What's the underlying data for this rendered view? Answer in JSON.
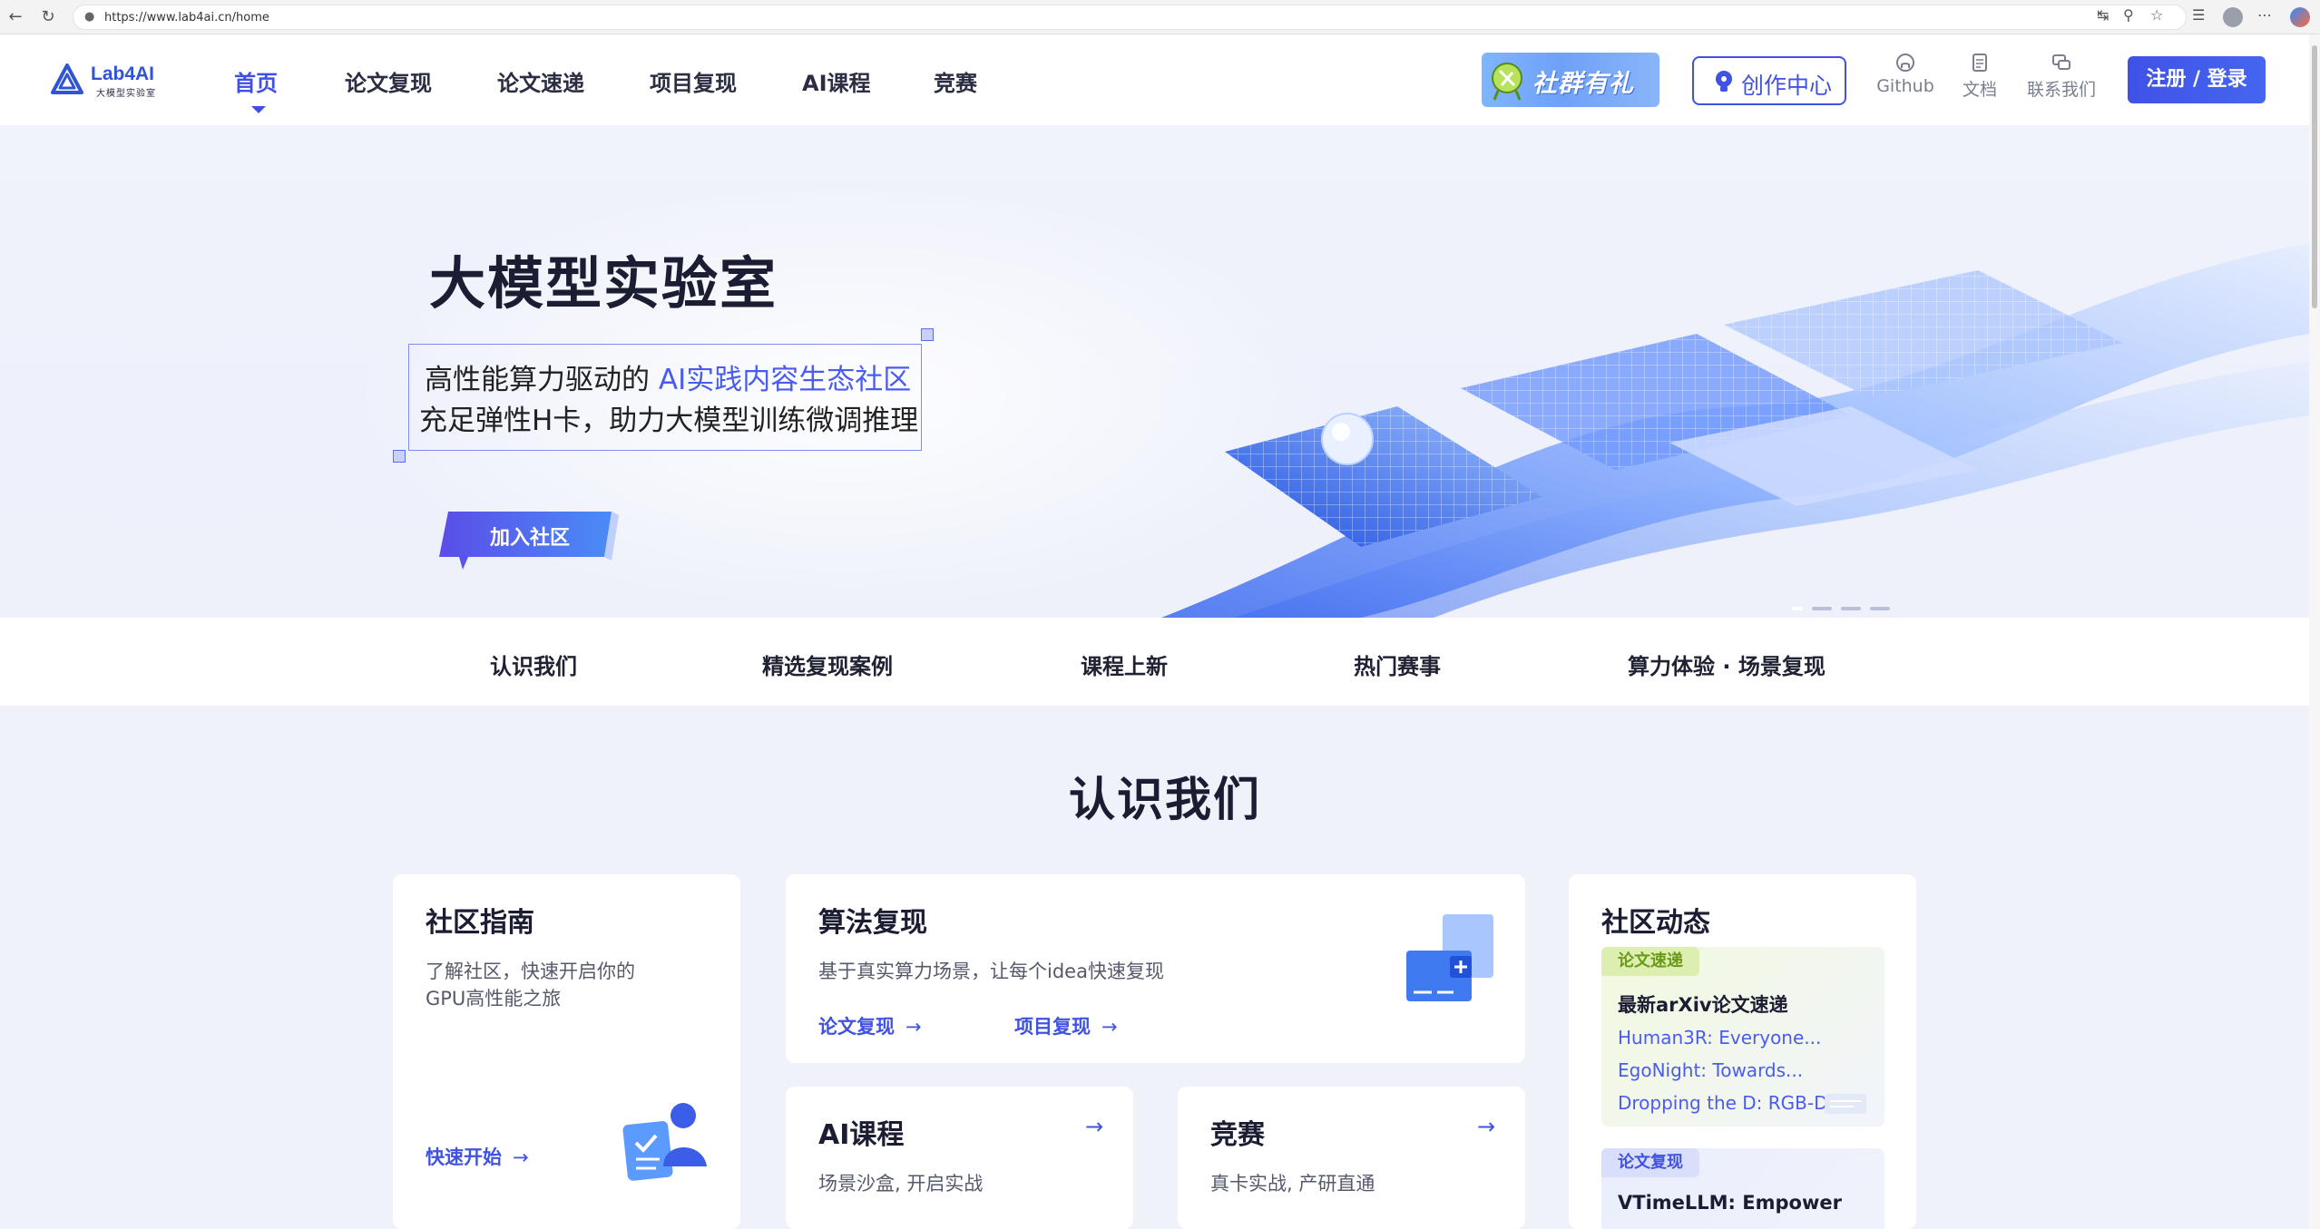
{
  "browser": {
    "url": "https://www.lab4ai.cn/home"
  },
  "header": {
    "logo_title": "Lab4AI",
    "logo_subtitle": "大模型实验室",
    "nav": [
      {
        "label": "首页",
        "active": true
      },
      {
        "label": "论文复现"
      },
      {
        "label": "论文速递"
      },
      {
        "label": "项目复现"
      },
      {
        "label": "AI课程"
      },
      {
        "label": "竞赛"
      }
    ],
    "promo_label": "社群有礼",
    "create_label": "创作中心",
    "tools": [
      {
        "label": "Github",
        "icon": "github-icon"
      },
      {
        "label": "文档",
        "icon": "document-icon"
      },
      {
        "label": "联系我们",
        "icon": "chat-icon"
      }
    ],
    "login_label": "注册 / 登录"
  },
  "hero": {
    "title": "大模型实验室",
    "line1_prefix": "高性能算力驱动的 ",
    "line1_highlight": "AI实践内容生态社区",
    "line2": "充足弹性H卡，助力大模型训练微调推理",
    "cta_label": "加入社区"
  },
  "section_nav": [
    "认识我们",
    "精选复现案例",
    "课程上新",
    "热门赛事",
    "算力体验 · 场景复现"
  ],
  "about": {
    "title": "认识我们",
    "guide": {
      "title": "社区指南",
      "desc_line1": "了解社区，快速开启你的",
      "desc_line2": "GPU高性能之旅",
      "link": "快速开始"
    },
    "algo": {
      "title": "算法复现",
      "desc": "基于真实算力场景，让每个idea快速复现",
      "link1": "论文复现",
      "link2": "项目复现"
    },
    "course": {
      "title": "AI课程",
      "desc": "场景沙盒, 开启实战"
    },
    "contest": {
      "title": "竞赛",
      "desc": "真卡实战, 产研直通"
    },
    "feed": {
      "title": "社区动态",
      "block1": {
        "tag": "论文速递",
        "headline": "最新arXiv论文速递",
        "items": [
          "Human3R: Everyone...",
          "EgoNight: Towards...",
          "Dropping the D: RGB-D..."
        ]
      },
      "block2": {
        "tag": "论文复现",
        "headline": "VTimeLLM: Empower"
      }
    }
  },
  "colors": {
    "brand": "#3f52e2",
    "nav_active": "#3f4fe6",
    "content_bg": "#f0f2fa"
  }
}
